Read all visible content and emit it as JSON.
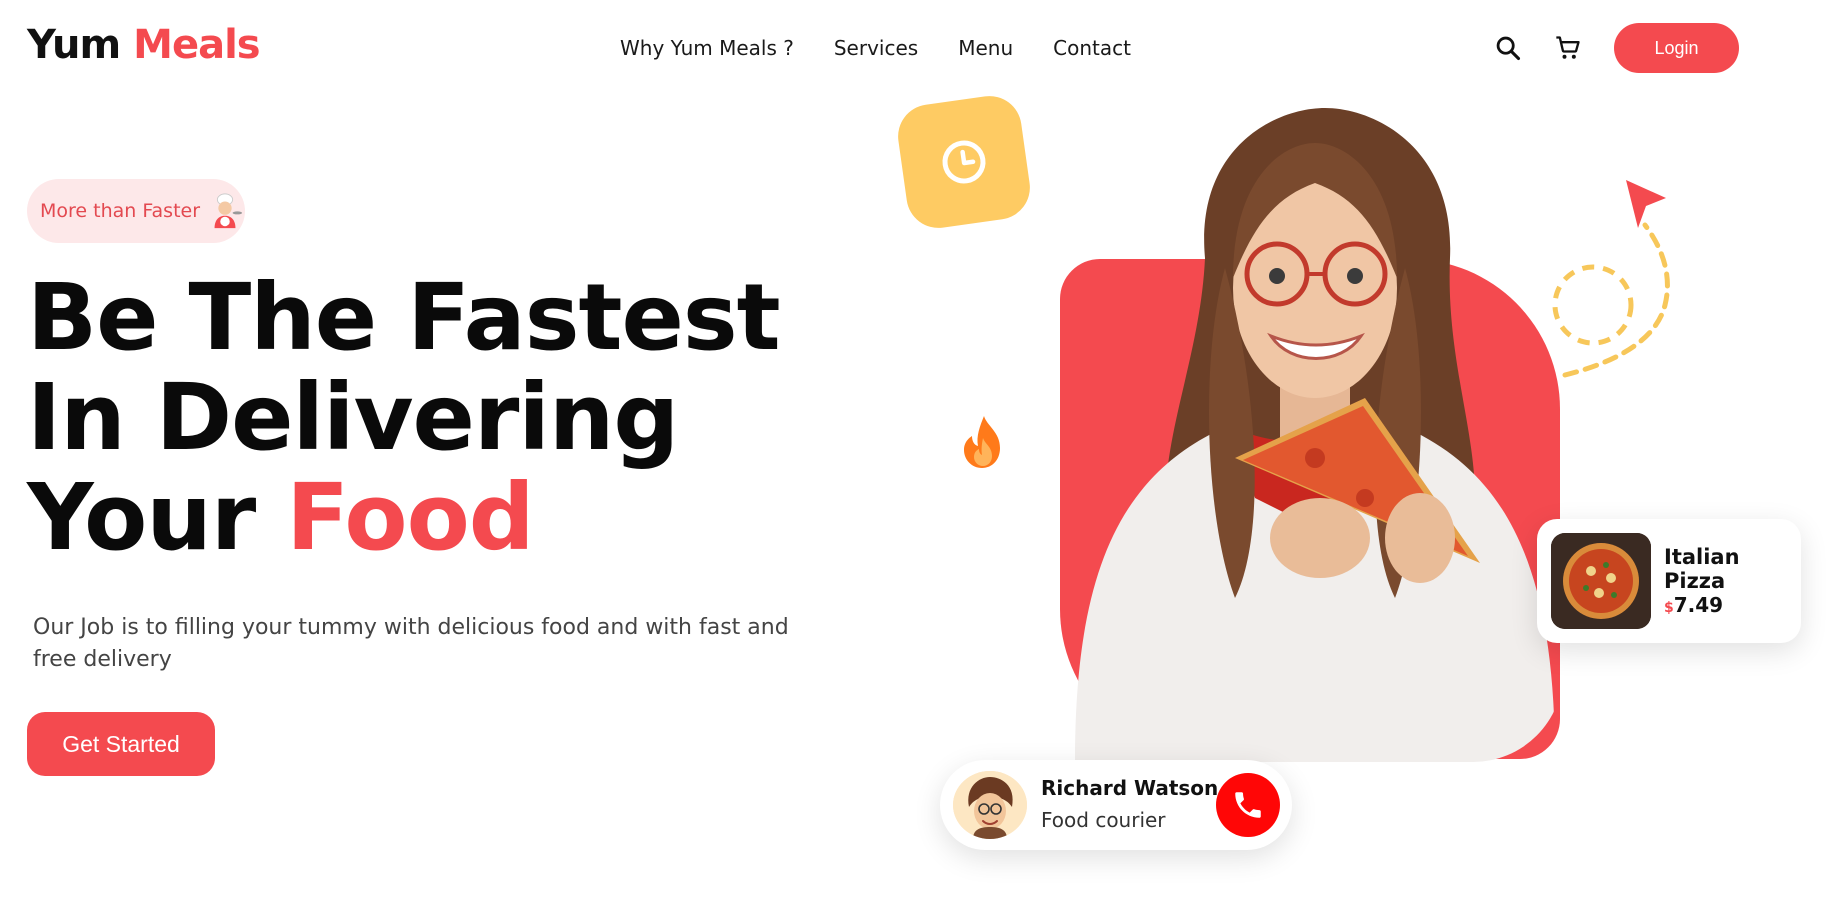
{
  "header": {
    "logo_part1": "Yum",
    "logo_part2": "Meals",
    "nav": [
      "Why Yum Meals ?",
      "Services",
      "Menu",
      "Contact"
    ],
    "icons": [
      "search-icon",
      "cart-icon"
    ],
    "login_label": "Login"
  },
  "hero": {
    "badge_text": "More than Faster",
    "headline_line1": "Be The Fastest",
    "headline_line2": "In Delivering",
    "headline_line3_plain": "Your",
    "headline_line3_accent": "Food",
    "description": "Our Job is to filling your tummy with delicious food and with fast and free delivery",
    "cta_label": "Get Started"
  },
  "cards": {
    "product_name": "Italian Pizza",
    "price_currency": "$",
    "price_value": "7.49",
    "courier_name": "Richard Watson",
    "courier_role": "Food courier"
  },
  "colors": {
    "accent": "#f44a4f",
    "yellow": "#fecb63",
    "call": "#ff0606"
  }
}
